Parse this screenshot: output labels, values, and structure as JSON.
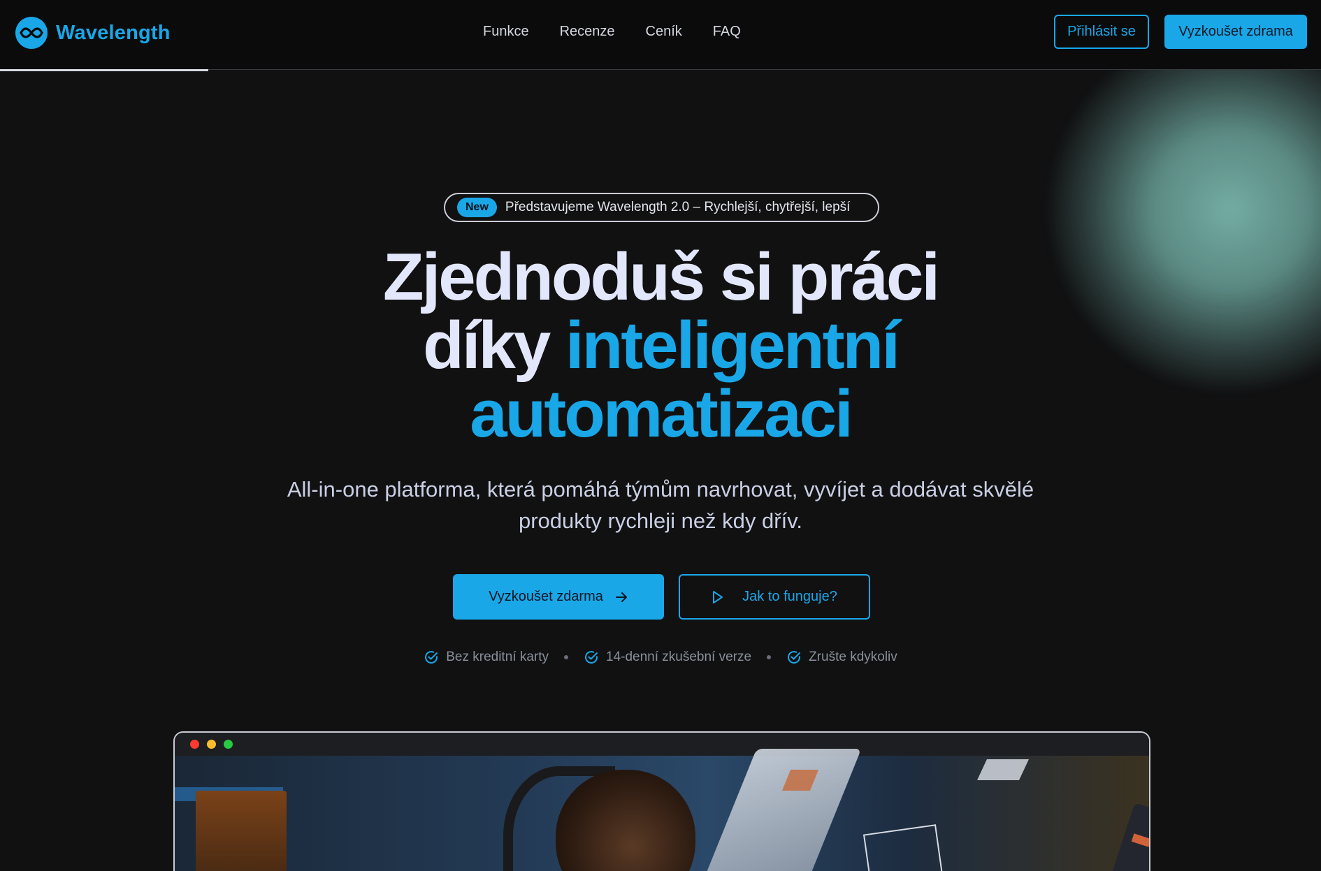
{
  "brand": {
    "name": "Wavelength",
    "color": "#19a7e8"
  },
  "nav": {
    "items": [
      {
        "label": "Funkce"
      },
      {
        "label": "Recenze"
      },
      {
        "label": "Ceník"
      },
      {
        "label": "FAQ"
      }
    ]
  },
  "header_actions": {
    "login_label": "Přihlásit se",
    "trial_label": "Vyzkoušet zdrama"
  },
  "announcement": {
    "badge": "New",
    "text": "Představujeme Wavelength 2.0 – Rychlejší, chytřejší, lepší"
  },
  "hero": {
    "line1": "Zjednoduš si práci",
    "line2_plain": "díky ",
    "line2_accent": "inteligentní",
    "line3_accent": "automatizaci",
    "subtitle_line1": "All-in-one platforma, která pomáhá týmům navrhovat, vyvíjet a dodávat skvělé",
    "subtitle_line2": "produkty rychleji než kdy dřív."
  },
  "cta": {
    "primary_label": "Vyzkoušet zdarma",
    "primary_icon": "arrow-right-icon",
    "secondary_label": "Jak to funguje?",
    "secondary_icon": "play-icon"
  },
  "features": [
    {
      "label": "Bez kreditní karty",
      "icon": "check-circle-icon"
    },
    {
      "label": "14-denní zkušební verze",
      "icon": "check-circle-icon"
    },
    {
      "label": "Zrušte kdykoliv",
      "icon": "check-circle-icon"
    }
  ],
  "browser_mockup": {
    "traffic_lights": [
      "#ff3b30",
      "#ffbd2e",
      "#28c840"
    ]
  }
}
